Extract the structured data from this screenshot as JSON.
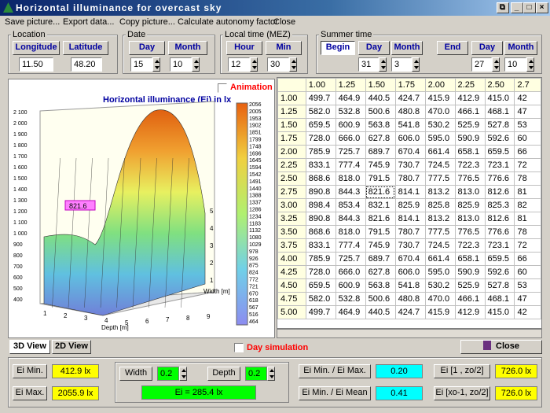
{
  "window": {
    "title": "Horizontal illuminance for overcast sky"
  },
  "menu": [
    "Save picture...",
    "Export data...",
    "Copy picture...",
    "Calculate autonomy factor",
    "Close"
  ],
  "location": {
    "group": "Location",
    "longitude_label": "Longitude",
    "latitude_label": "Latitude",
    "longitude": "11.50",
    "latitude": "48.20"
  },
  "date": {
    "group": "Date",
    "day_label": "Day",
    "month_label": "Month",
    "day": "15",
    "month": "10"
  },
  "time": {
    "group": "Local time (MEZ)",
    "hour_label": "Hour",
    "min_label": "Min",
    "hour": "12",
    "min": "30"
  },
  "summer": {
    "group": "Summer time",
    "begin": "Begin",
    "end": "End",
    "day_label": "Day",
    "month_label": "Month",
    "begin_day": "31",
    "begin_month": "3",
    "end_day": "27",
    "end_month": "10"
  },
  "chart": {
    "animation": "Animation",
    "title": "Horizontal illuminance (Ei) in lx",
    "callout": "821.6",
    "xlabel": "Depth [m]",
    "ylabel": "Width [m]",
    "legend": [
      "2056",
      "2005",
      "1953",
      "1902",
      "1851",
      "1799",
      "1748",
      "1696",
      "1645",
      "1594",
      "1542",
      "1491",
      "1440",
      "1388",
      "1337",
      "1286",
      "1234",
      "1183",
      "1132",
      "1080",
      "1029",
      "978",
      "926",
      "875",
      "824",
      "772",
      "721",
      "670",
      "618",
      "567",
      "516",
      "464"
    ],
    "zticks": [
      "2 100",
      "2 000",
      "1 900",
      "1 800",
      "1 700",
      "1 600",
      "1 500",
      "1 400",
      "1 300",
      "1 200",
      "1 100",
      "1 000",
      "900",
      "800",
      "700",
      "600",
      "500",
      "400"
    ],
    "xticks": [
      "1",
      "2",
      "3",
      "4",
      "5",
      "6",
      "7",
      "8",
      "9"
    ],
    "yticks": [
      "1",
      "2",
      "3",
      "4",
      "5"
    ]
  },
  "table": {
    "cols": [
      "1.00",
      "1.25",
      "1.50",
      "1.75",
      "2.00",
      "2.25",
      "2.50",
      "2.7"
    ],
    "rows": [
      [
        "1.00",
        "499.7",
        "464.9",
        "440.5",
        "424.7",
        "415.9",
        "412.9",
        "415.0",
        "42"
      ],
      [
        "1.25",
        "582.0",
        "532.8",
        "500.6",
        "480.8",
        "470.0",
        "466.1",
        "468.1",
        "47"
      ],
      [
        "1.50",
        "659.5",
        "600.9",
        "563.8",
        "541.8",
        "530.2",
        "525.9",
        "527.8",
        "53"
      ],
      [
        "1.75",
        "728.0",
        "666.0",
        "627.8",
        "606.0",
        "595.0",
        "590.9",
        "592.6",
        "60"
      ],
      [
        "2.00",
        "785.9",
        "725.7",
        "689.7",
        "670.4",
        "661.4",
        "658.1",
        "659.5",
        "66"
      ],
      [
        "2.25",
        "833.1",
        "777.4",
        "745.9",
        "730.7",
        "724.5",
        "722.3",
        "723.1",
        "72"
      ],
      [
        "2.50",
        "868.6",
        "818.0",
        "791.5",
        "780.7",
        "777.5",
        "776.5",
        "776.6",
        "78"
      ],
      [
        "2.75",
        "890.8",
        "844.3",
        "821.6",
        "814.1",
        "813.2",
        "813.0",
        "812.6",
        "81"
      ],
      [
        "3.00",
        "898.4",
        "853.4",
        "832.1",
        "825.9",
        "825.8",
        "825.9",
        "825.3",
        "82"
      ],
      [
        "3.25",
        "890.8",
        "844.3",
        "821.6",
        "814.1",
        "813.2",
        "813.0",
        "812.6",
        "81"
      ],
      [
        "3.50",
        "868.6",
        "818.0",
        "791.5",
        "780.7",
        "777.5",
        "776.5",
        "776.6",
        "78"
      ],
      [
        "3.75",
        "833.1",
        "777.4",
        "745.9",
        "730.7",
        "724.5",
        "722.3",
        "723.1",
        "72"
      ],
      [
        "4.00",
        "785.9",
        "725.7",
        "689.7",
        "670.4",
        "661.4",
        "658.1",
        "659.5",
        "66"
      ],
      [
        "4.25",
        "728.0",
        "666.0",
        "627.8",
        "606.0",
        "595.0",
        "590.9",
        "592.6",
        "60"
      ],
      [
        "4.50",
        "659.5",
        "600.9",
        "563.8",
        "541.8",
        "530.2",
        "525.9",
        "527.8",
        "53"
      ],
      [
        "4.75",
        "582.0",
        "532.8",
        "500.6",
        "480.8",
        "470.0",
        "466.1",
        "468.1",
        "47"
      ],
      [
        "5.00",
        "499.7",
        "464.9",
        "440.5",
        "424.7",
        "415.9",
        "412.9",
        "415.0",
        "42"
      ]
    ]
  },
  "tabs": {
    "view3d": "3D View",
    "view2d": "2D View"
  },
  "day_simulation": "Day simulation",
  "close": "Close",
  "stats": {
    "ei_min_label": "Ei Min.",
    "ei_min": "412.9 lx",
    "ei_max_label": "Ei Max.",
    "ei_max": "2055.9 lx",
    "width_label": "Width",
    "width": "0.2",
    "depth_label": "Depth",
    "depth": "0.2",
    "ei_readout": "Ei = 285.4  lx",
    "ratio1_label": "Ei Min. / Ei Max.",
    "ratio1": "0.20",
    "ratio2_label": "Ei Min. / Ei Mean",
    "ratio2": "0.41",
    "ei1_label": "Ei [1 , zo/2]",
    "ei1": "726.0 lx",
    "ei2_label": "Ei [xo-1, zo/2]",
    "ei2": "726.0 lx"
  },
  "colors": {
    "highlight_yellow": "#ffff00",
    "cyan": "#00ffff",
    "green": "#00ff00",
    "red_label": "#ff0000"
  }
}
